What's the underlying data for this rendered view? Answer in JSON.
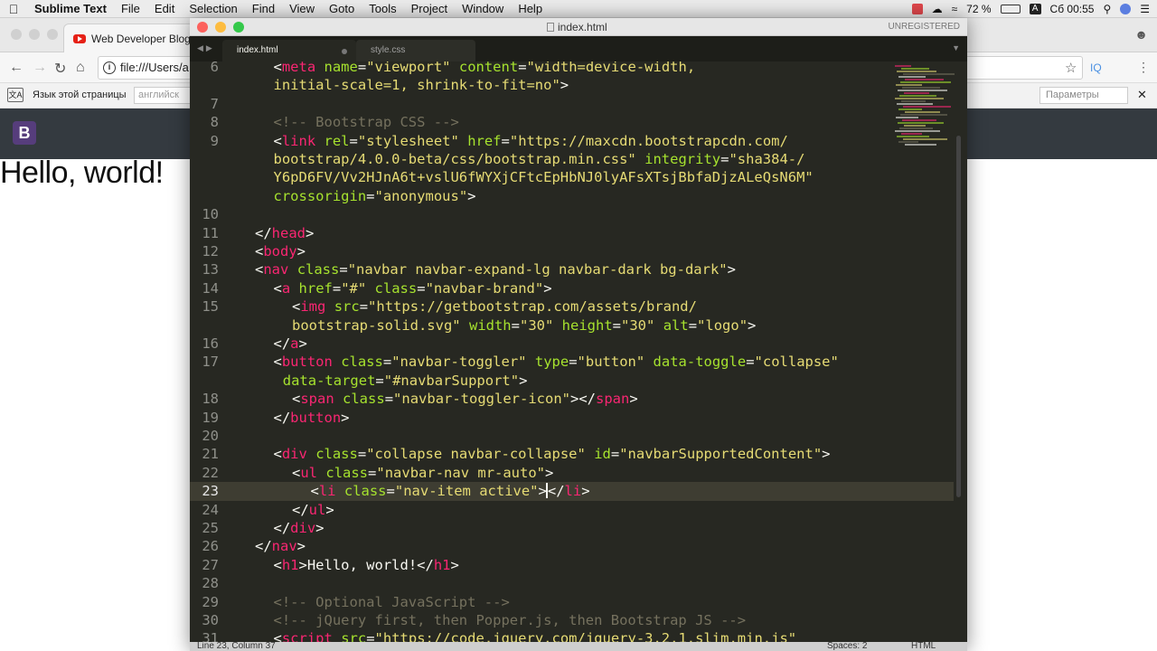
{
  "menubar": {
    "app_name": "Sublime Text",
    "items": [
      "File",
      "Edit",
      "Selection",
      "Find",
      "View",
      "Goto",
      "Tools",
      "Project",
      "Window",
      "Help"
    ],
    "battery": "72 %",
    "clock": "Сб 00:55",
    "input_lang": "A"
  },
  "browser": {
    "tab_title": "Web Developer Blog -",
    "url": "file:///Users/a",
    "translate_label": "Язык этой страницы",
    "translate_lang": "английск",
    "translate_params": "Параметры",
    "brand_letter": "B",
    "heading": "Hello, world!"
  },
  "sublime": {
    "window_title": "index.html",
    "unregistered": "UNREGISTERED",
    "tabs": [
      {
        "label": "index.html",
        "active": true
      },
      {
        "label": "style.css",
        "active": false
      }
    ],
    "status_left": "Line 23, Column 37",
    "status_spaces": "Spaces: 2",
    "status_syntax": "HTML",
    "current_line": 23
  },
  "code_lines": [
    {
      "num": "6",
      "indent": 1,
      "segs": [
        [
          "p",
          "<"
        ],
        [
          "t",
          "meta"
        ],
        [
          "p",
          " "
        ],
        [
          "a",
          "name"
        ],
        [
          "p",
          "="
        ],
        [
          "s",
          "\"viewport\""
        ],
        [
          "p",
          " "
        ],
        [
          "a",
          "content"
        ],
        [
          "p",
          "="
        ],
        [
          "s",
          "\"width=device-width,"
        ]
      ]
    },
    {
      "num": "",
      "indent": 1,
      "segs": [
        [
          "s",
          "initial-scale=1, shrink-to-fit=no\""
        ],
        [
          "p",
          ">"
        ]
      ]
    },
    {
      "num": "7",
      "indent": 0,
      "segs": []
    },
    {
      "num": "8",
      "indent": 1,
      "segs": [
        [
          "c",
          "<!-- Bootstrap CSS -->"
        ]
      ]
    },
    {
      "num": "9",
      "indent": 1,
      "segs": [
        [
          "p",
          "<"
        ],
        [
          "t",
          "link"
        ],
        [
          "p",
          " "
        ],
        [
          "a",
          "rel"
        ],
        [
          "p",
          "="
        ],
        [
          "s",
          "\"stylesheet\""
        ],
        [
          "p",
          " "
        ],
        [
          "a",
          "href"
        ],
        [
          "p",
          "="
        ],
        [
          "s",
          "\"https://maxcdn.bootstrapcdn.com/"
        ]
      ]
    },
    {
      "num": "",
      "indent": 1,
      "segs": [
        [
          "s",
          "bootstrap/4.0.0-beta/css/bootstrap.min.css\""
        ],
        [
          "p",
          " "
        ],
        [
          "a",
          "integrity"
        ],
        [
          "p",
          "="
        ],
        [
          "s",
          "\"sha384-/"
        ]
      ]
    },
    {
      "num": "",
      "indent": 1,
      "segs": [
        [
          "s",
          "Y6pD6FV/Vv2HJnA6t+vslU6fWYXjCFtcEpHbNJ0lyAFsXTsjBbfaDjzALeQsN6M\""
        ]
      ]
    },
    {
      "num": "",
      "indent": 1,
      "segs": [
        [
          "a",
          "crossorigin"
        ],
        [
          "p",
          "="
        ],
        [
          "s",
          "\"anonymous\""
        ],
        [
          "p",
          ">"
        ]
      ]
    },
    {
      "num": "10",
      "indent": 0,
      "segs": []
    },
    {
      "num": "11",
      "indent": 0,
      "segs": [
        [
          "p",
          "</"
        ],
        [
          "t",
          "head"
        ],
        [
          "p",
          ">"
        ]
      ]
    },
    {
      "num": "12",
      "indent": 0,
      "segs": [
        [
          "p",
          "<"
        ],
        [
          "t",
          "body"
        ],
        [
          "p",
          ">"
        ]
      ]
    },
    {
      "num": "13",
      "indent": 0,
      "segs": [
        [
          "p",
          "<"
        ],
        [
          "t",
          "nav"
        ],
        [
          "p",
          " "
        ],
        [
          "a",
          "class"
        ],
        [
          "p",
          "="
        ],
        [
          "s",
          "\"navbar navbar-expand-lg navbar-dark bg-dark\""
        ],
        [
          "p",
          ">"
        ]
      ]
    },
    {
      "num": "14",
      "indent": 1,
      "segs": [
        [
          "p",
          "<"
        ],
        [
          "t",
          "a"
        ],
        [
          "p",
          " "
        ],
        [
          "a",
          "href"
        ],
        [
          "p",
          "="
        ],
        [
          "s",
          "\"#\""
        ],
        [
          "p",
          " "
        ],
        [
          "a",
          "class"
        ],
        [
          "p",
          "="
        ],
        [
          "s",
          "\"navbar-brand\""
        ],
        [
          "p",
          ">"
        ]
      ]
    },
    {
      "num": "15",
      "indent": 2,
      "segs": [
        [
          "p",
          "<"
        ],
        [
          "t",
          "img"
        ],
        [
          "p",
          " "
        ],
        [
          "a",
          "src"
        ],
        [
          "p",
          "="
        ],
        [
          "s",
          "\"https://getbootstrap.com/assets/brand/"
        ]
      ]
    },
    {
      "num": "",
      "indent": 2,
      "segs": [
        [
          "s",
          "bootstrap-solid.svg\""
        ],
        [
          "p",
          " "
        ],
        [
          "a",
          "width"
        ],
        [
          "p",
          "="
        ],
        [
          "s",
          "\"30\""
        ],
        [
          "p",
          " "
        ],
        [
          "a",
          "height"
        ],
        [
          "p",
          "="
        ],
        [
          "s",
          "\"30\""
        ],
        [
          "p",
          " "
        ],
        [
          "a",
          "alt"
        ],
        [
          "p",
          "="
        ],
        [
          "s",
          "\"logo\""
        ],
        [
          "p",
          ">"
        ]
      ]
    },
    {
      "num": "16",
      "indent": 1,
      "segs": [
        [
          "p",
          "</"
        ],
        [
          "t",
          "a"
        ],
        [
          "p",
          ">"
        ]
      ]
    },
    {
      "num": "17",
      "indent": 1,
      "segs": [
        [
          "p",
          "<"
        ],
        [
          "t",
          "button"
        ],
        [
          "p",
          " "
        ],
        [
          "a",
          "class"
        ],
        [
          "p",
          "="
        ],
        [
          "s",
          "\"navbar-toggler\""
        ],
        [
          "p",
          " "
        ],
        [
          "a",
          "type"
        ],
        [
          "p",
          "="
        ],
        [
          "s",
          "\"button\""
        ],
        [
          "p",
          " "
        ],
        [
          "a",
          "data-toggle"
        ],
        [
          "p",
          "="
        ],
        [
          "s",
          "\"collapse\""
        ]
      ]
    },
    {
      "num": "",
      "indent": 1.5,
      "segs": [
        [
          "a",
          "data-target"
        ],
        [
          "p",
          "="
        ],
        [
          "s",
          "\"#navbarSupport\""
        ],
        [
          "p",
          ">"
        ]
      ]
    },
    {
      "num": "18",
      "indent": 2,
      "segs": [
        [
          "p",
          "<"
        ],
        [
          "t",
          "span"
        ],
        [
          "p",
          " "
        ],
        [
          "a",
          "class"
        ],
        [
          "p",
          "="
        ],
        [
          "s",
          "\"navbar-toggler-icon\""
        ],
        [
          "p",
          "></"
        ],
        [
          "t",
          "span"
        ],
        [
          "p",
          ">"
        ]
      ]
    },
    {
      "num": "19",
      "indent": 1,
      "segs": [
        [
          "p",
          "</"
        ],
        [
          "t",
          "button"
        ],
        [
          "p",
          ">"
        ]
      ]
    },
    {
      "num": "20",
      "indent": 0,
      "segs": []
    },
    {
      "num": "21",
      "indent": 1,
      "segs": [
        [
          "p",
          "<"
        ],
        [
          "t",
          "div"
        ],
        [
          "p",
          " "
        ],
        [
          "a",
          "class"
        ],
        [
          "p",
          "="
        ],
        [
          "s",
          "\"collapse navbar-collapse\""
        ],
        [
          "p",
          " "
        ],
        [
          "a",
          "id"
        ],
        [
          "p",
          "="
        ],
        [
          "s",
          "\"navbarSupportedContent\""
        ],
        [
          "p",
          ">"
        ]
      ]
    },
    {
      "num": "22",
      "indent": 2,
      "segs": [
        [
          "p",
          "<"
        ],
        [
          "t",
          "ul"
        ],
        [
          "p",
          " "
        ],
        [
          "a",
          "class"
        ],
        [
          "p",
          "="
        ],
        [
          "s",
          "\"navbar-nav mr-auto\""
        ],
        [
          "p",
          ">"
        ]
      ]
    },
    {
      "num": "23",
      "indent": 3,
      "segs": [
        [
          "p",
          "<"
        ],
        [
          "t",
          "li"
        ],
        [
          "p",
          " "
        ],
        [
          "a",
          "class"
        ],
        [
          "p",
          "="
        ],
        [
          "s",
          "\"nav-item active\""
        ],
        [
          "p",
          ">"
        ],
        [
          "cursor",
          ""
        ],
        [
          "p",
          "</"
        ],
        [
          "t",
          "li"
        ],
        [
          "p",
          ">"
        ]
      ]
    },
    {
      "num": "24",
      "indent": 2,
      "segs": [
        [
          "p",
          "</"
        ],
        [
          "t",
          "ul"
        ],
        [
          "p",
          ">"
        ]
      ]
    },
    {
      "num": "25",
      "indent": 1,
      "segs": [
        [
          "p",
          "</"
        ],
        [
          "t",
          "div"
        ],
        [
          "p",
          ">"
        ]
      ]
    },
    {
      "num": "26",
      "indent": 0,
      "segs": [
        [
          "p",
          "</"
        ],
        [
          "t",
          "nav"
        ],
        [
          "p",
          ">"
        ]
      ]
    },
    {
      "num": "27",
      "indent": 1,
      "segs": [
        [
          "p",
          "<"
        ],
        [
          "t",
          "h1"
        ],
        [
          "p",
          ">Hello, world!</"
        ],
        [
          "t",
          "h1"
        ],
        [
          "p",
          ">"
        ]
      ]
    },
    {
      "num": "28",
      "indent": 0,
      "segs": []
    },
    {
      "num": "29",
      "indent": 1,
      "segs": [
        [
          "c",
          "<!-- Optional JavaScript -->"
        ]
      ]
    },
    {
      "num": "30",
      "indent": 1,
      "segs": [
        [
          "c",
          "<!-- jQuery first, then Popper.js, then Bootstrap JS -->"
        ]
      ]
    },
    {
      "num": "31",
      "indent": 1,
      "segs": [
        [
          "p",
          "<"
        ],
        [
          "t",
          "script"
        ],
        [
          "p",
          " "
        ],
        [
          "a",
          "src"
        ],
        [
          "p",
          "="
        ],
        [
          "s",
          "\"https://code.jquery.com/jquery-3.2.1.slim.min.js\""
        ]
      ]
    }
  ],
  "colors": {
    "editor_bg": "#272822",
    "tag": "#f92672",
    "attr": "#a6e22e",
    "string": "#e6db74",
    "comment": "#75715e"
  }
}
